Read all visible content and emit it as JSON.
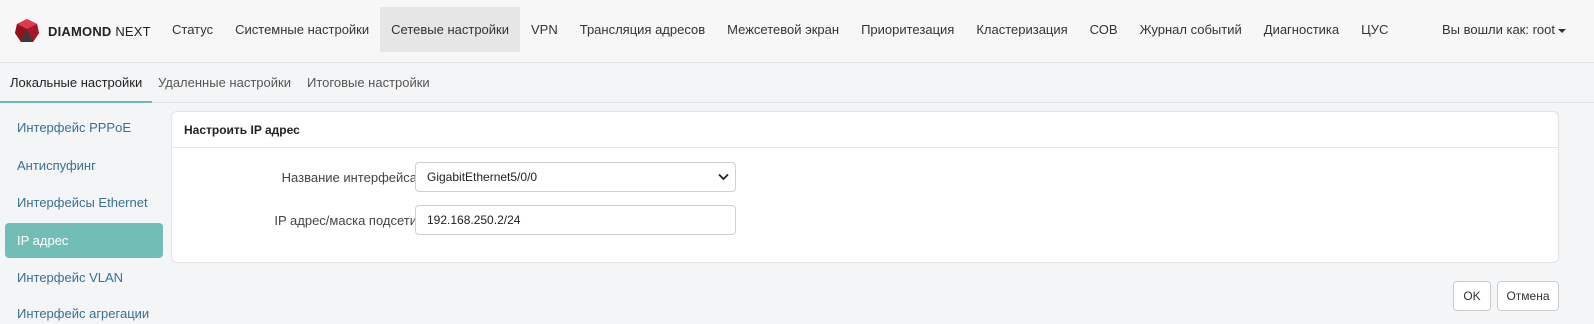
{
  "brand": {
    "name_bold": "DIAMOND",
    "name_rest": "NEXT"
  },
  "nav": [
    {
      "label": "Статус"
    },
    {
      "label": "Системные настройки"
    },
    {
      "label": "Сетевые настройки",
      "active": true
    },
    {
      "label": "VPN"
    },
    {
      "label": "Трансляция адресов"
    },
    {
      "label": "Межсетевой экран"
    },
    {
      "label": "Приоритезация"
    },
    {
      "label": "Кластеризация"
    },
    {
      "label": "СОВ"
    },
    {
      "label": "Журнал событий"
    },
    {
      "label": "Диагностика"
    },
    {
      "label": "ЦУС"
    }
  ],
  "user_menu": {
    "label": "Вы вошли как: root"
  },
  "subtabs": [
    {
      "label": "Локальные настройки",
      "active": true
    },
    {
      "label": "Удаленные настройки"
    },
    {
      "label": "Итоговые настройки"
    }
  ],
  "sidebar": [
    {
      "label": "Интерфейс PPPoE"
    },
    {
      "label": "Антиспуфинг"
    },
    {
      "label": "Интерфейсы Ethernet"
    },
    {
      "label": "IP адрес",
      "active": true
    },
    {
      "label": "Интерфейс VLAN"
    },
    {
      "label": "Интерфейс агрегации"
    }
  ],
  "panel": {
    "title": "Настроить IP адрес",
    "interface_label": "Название интерфейса",
    "interface_value": "GigabitEthernet5/0/0",
    "ip_label": "IP адрес/маска подсети",
    "ip_value": "192.168.250.2/24"
  },
  "buttons": {
    "ok": "OK",
    "cancel": "Отмена"
  },
  "colors": {
    "accent": "#72beb6",
    "link": "#3a6f93",
    "logo_red": "#c8202f"
  }
}
